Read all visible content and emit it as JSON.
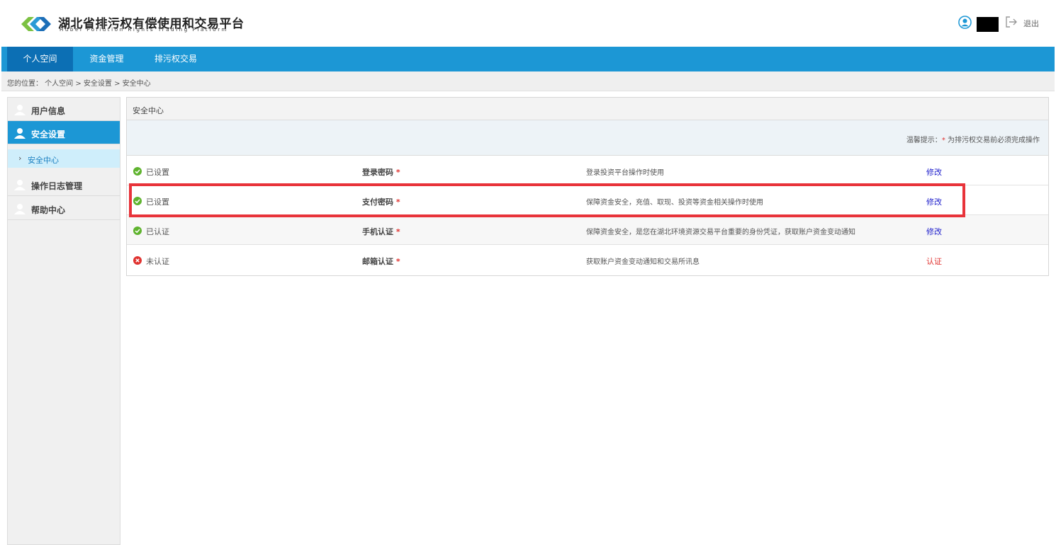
{
  "header": {
    "brand_cn": "湖北省排污权有偿使用和交易平台",
    "brand_en": "Hubei Pollution Rights Trading Platform",
    "logout_label": "退出"
  },
  "nav": {
    "items": [
      "个人空间",
      "资金管理",
      "排污权交易"
    ],
    "active": "个人空间"
  },
  "breadcrumb": {
    "text": "您的位置： 个人空间 > 安全设置 > 安全中心"
  },
  "sidebar": {
    "items": [
      "用户信息",
      "安全设置",
      "操作日志管理",
      "帮助中心"
    ],
    "active": "安全设置",
    "sub_item": "安全中心"
  },
  "panel": {
    "title": "安全中心",
    "tip_prefix": "温馨提示：",
    "tip_star": "*",
    "tip_text": " 为排污权交易前必须完成操作",
    "rows": [
      {
        "status": "已设置",
        "ok": true,
        "name": "登录密码",
        "desc": "登录投资平台操作时使用",
        "action": "修改"
      },
      {
        "status": "已设置",
        "ok": true,
        "name": "支付密码",
        "desc": "保障资金安全，充值、取现、投资等资金相关操作时使用",
        "action": "修改"
      },
      {
        "status": "已认证",
        "ok": true,
        "name": "手机认证",
        "desc": "保障资金安全，是您在湖北环境资源交易平台重要的身份凭证，获取账户资金变动通知",
        "action": "修改"
      },
      {
        "status": "未认证",
        "ok": false,
        "name": "邮箱认证",
        "desc": "获取账户资金变动通知和交易所讯息",
        "action": "认证"
      }
    ],
    "required_mark": "*"
  },
  "colors": {
    "nav_bg": "#1c97d5",
    "nav_active": "#0c6fb4",
    "ok_green": "#5fb32e",
    "error_red": "#e0322f",
    "highlight_red": "#e8333a"
  }
}
